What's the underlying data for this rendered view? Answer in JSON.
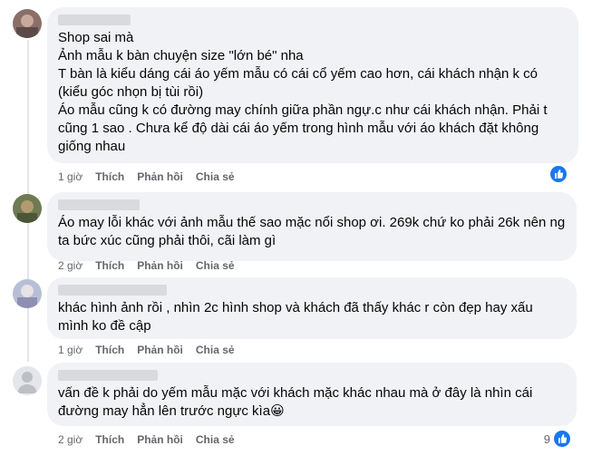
{
  "comments": [
    {
      "avatar_icon": "user-avatar-photo",
      "text": "Shop sai mà\nẢnh mẫu k bàn chuyện size \"lớn bé\" nha\nT bàn là kiểu dáng cái áo yếm mẫu có cái cổ yếm cao hơn, cái khách nhận k có (kiểu góc nhọn bị tùi rồi)\nÁo mẫu cũng k có đường may chính giữa phần ngự.c như cái khách nhận. Phải t cũng 1 sao . Chưa kể độ dài cái áo yếm trong hình mẫu với áo khách đặt không giống nhau",
      "time": "1 giờ",
      "like": "Thích",
      "reply": "Phản hồi",
      "share": "Chia sẻ",
      "reaction_icon": "like-icon",
      "reaction_count": ""
    },
    {
      "avatar_icon": "user-avatar-photo",
      "text": "Áo may lỗi khác với ảnh mẫu thế sao mặc nổi shop ơi. 269k chứ ko phải 26k nên ng ta bức xúc cũng phải thôi, cãi làm gì",
      "time": "2 giờ",
      "like": "Thích",
      "reply": "Phản hồi",
      "share": "Chia sẻ",
      "reaction_icon": "",
      "reaction_count": ""
    },
    {
      "avatar_icon": "user-avatar-photo",
      "text": "khác hình ảnh rồi , nhìn 2c hình shop và khách đã thấy khác r còn đẹp hay xấu mình ko đề cập",
      "time": "1 giờ",
      "like": "Thích",
      "reply": "Phản hồi",
      "share": "Chia sẻ",
      "reaction_icon": "",
      "reaction_count": ""
    },
    {
      "avatar_icon": "default-user-avatar",
      "text": "vấn đề k phải do yếm mẫu mặc với khách mặc khác nhau mà ở đây là nhìn cái đường may hẳn lên trước ngực kìa😀",
      "time": "2 giờ",
      "like": "Thích",
      "reply": "Phản hồi",
      "share": "Chia sẻ",
      "reaction_icon": "like-icon",
      "reaction_count": "9"
    }
  ]
}
